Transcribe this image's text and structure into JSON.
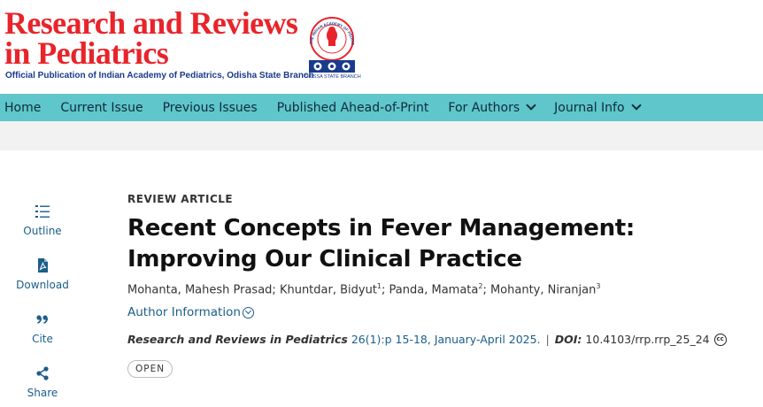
{
  "header": {
    "title_line1": "Research and Reviews",
    "title_line2": "in Pediatrics",
    "tagline": "Official Publication of Indian Academy of Pediatrics, Odisha State Branch",
    "logo_caption": "ORISSA STATE BRANCH",
    "logo_ring_text": "THE INDIAN ACADEMY OF PEDIATRICS"
  },
  "nav": {
    "items": [
      {
        "label": "Home"
      },
      {
        "label": "Current Issue"
      },
      {
        "label": "Previous Issues"
      },
      {
        "label": "Published Ahead-of-Print"
      },
      {
        "label": "For Authors",
        "dropdown": true
      },
      {
        "label": "Journal Info",
        "dropdown": true
      }
    ]
  },
  "tools": {
    "outline": "Outline",
    "download": "Download",
    "cite": "Cite",
    "share": "Share"
  },
  "article": {
    "type": "REVIEW ARTICLE",
    "title": "Recent Concepts in Fever Management: Improving Our Clinical Practice",
    "authors": [
      {
        "name": "Mohanta, Mahesh Prasad",
        "sup": ""
      },
      {
        "name": "Khuntdar, Bidyut",
        "sup": "1"
      },
      {
        "name": "Panda, Mamata",
        "sup": "2"
      },
      {
        "name": "Mohanty, Niranjan",
        "sup": "3"
      }
    ],
    "author_info_label": "Author Information",
    "journal_name": "Research and Reviews in Pediatrics",
    "issue_info": "26(1):p 15-18, January-April 2025.",
    "doi_label": "DOI:",
    "doi": "10.4103/rrp.rrp_25_24",
    "license_icon_text": "cc",
    "access_badge": "OPEN"
  },
  "colors": {
    "brand_red": "#e8242a",
    "brand_navy": "#1a3a8c",
    "nav_bg": "#5fc6cb",
    "link": "#1b5e8a"
  }
}
